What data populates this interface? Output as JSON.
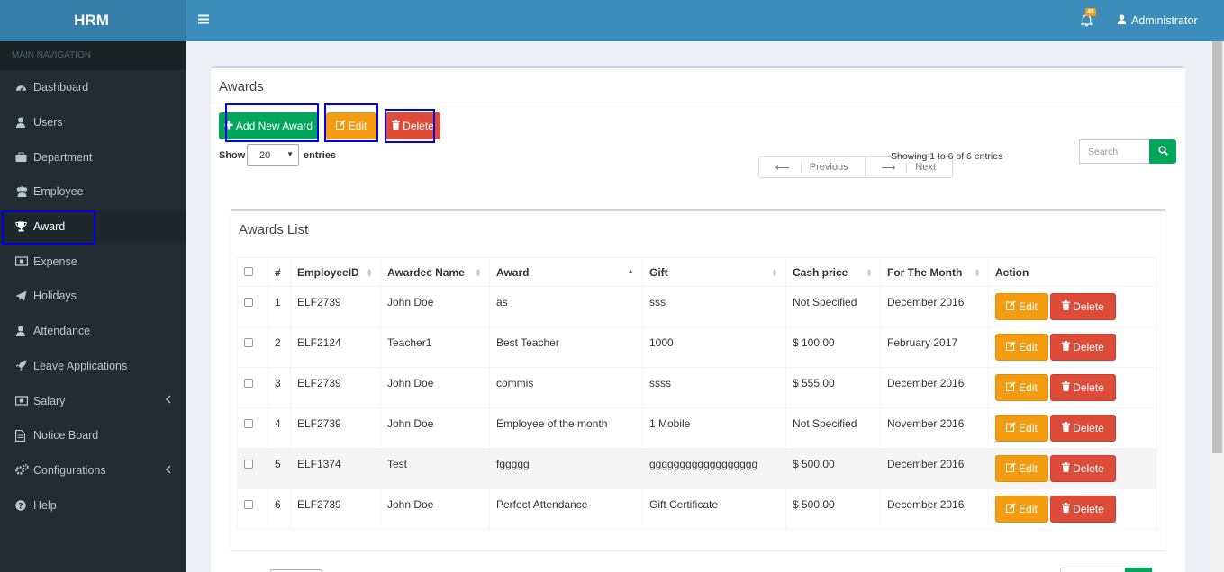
{
  "app": {
    "title": "HRM"
  },
  "sidebar": {
    "header": "MAIN NAVIGATION",
    "items": [
      {
        "label": "Dashboard",
        "icon": "dashboard-icon"
      },
      {
        "label": "Users",
        "icon": "user-icon"
      },
      {
        "label": "Department",
        "icon": "briefcase-icon"
      },
      {
        "label": "Employee",
        "icon": "users-icon"
      },
      {
        "label": "Award",
        "icon": "trophy-icon"
      },
      {
        "label": "Expense",
        "icon": "money-icon"
      },
      {
        "label": "Holidays",
        "icon": "paper-plane-icon"
      },
      {
        "label": "Attendance",
        "icon": "user-icon"
      },
      {
        "label": "Leave Applications",
        "icon": "rocket-icon"
      },
      {
        "label": "Salary",
        "icon": "money-icon"
      },
      {
        "label": "Notice Board",
        "icon": "file-icon"
      },
      {
        "label": "Configurations",
        "icon": "gears-icon"
      },
      {
        "label": "Help",
        "icon": "question-circle-icon"
      }
    ]
  },
  "header": {
    "notification_count": "45",
    "user_name": "Administrator"
  },
  "page": {
    "title": "Awards",
    "add_label": "Add New Award",
    "edit_label": "Edit",
    "delete_label": "Delete",
    "show_label": "Show",
    "page_size": "20",
    "entries_label": "entries",
    "previous_label": "Previous",
    "next_label": "Next",
    "showing_text": "Showing 1 to 6 of 6 entries",
    "search_placeholder": "Search"
  },
  "list": {
    "title": "Awards List",
    "columns": [
      "#",
      "EmployeeID",
      "Awardee Name",
      "Award",
      "Gift",
      "Cash price",
      "For The Month",
      "Action"
    ],
    "edit_label": "Edit",
    "delete_label": "Delete",
    "rows": [
      {
        "num": "1",
        "employee_id": "ELF2739",
        "name": "John Doe",
        "award": "as",
        "gift": "sss",
        "cash": "Not Specified",
        "month": "December 2016"
      },
      {
        "num": "2",
        "employee_id": "ELF2124",
        "name": "Teacher1",
        "award": "Best Teacher",
        "gift": "1000",
        "cash": "$ 100.00",
        "month": "February 2017"
      },
      {
        "num": "3",
        "employee_id": "ELF2739",
        "name": "John Doe",
        "award": "commis",
        "gift": "ssss",
        "cash": "$ 555.00",
        "month": "December 2016"
      },
      {
        "num": "4",
        "employee_id": "ELF2739",
        "name": "John Doe",
        "award": "Employee of the month",
        "gift": "1 Mobile",
        "cash": "Not Specified",
        "month": "November 2016"
      },
      {
        "num": "5",
        "employee_id": "ELF1374",
        "name": "Test",
        "award": "fggggg",
        "gift": "gggggggggggggggggg",
        "cash": "$ 500.00",
        "month": "December 2016"
      },
      {
        "num": "6",
        "employee_id": "ELF2739",
        "name": "John Doe",
        "award": "Perfect Attendance",
        "gift": "Gift Certificate",
        "cash": "$ 500.00",
        "month": "December 2016"
      }
    ]
  },
  "colors": {
    "sidebar": "#222d32",
    "header": "#3c8dbc",
    "logo": "#367fa9",
    "success": "#00a65a",
    "warning": "#f39c12",
    "danger": "#dd4b39",
    "highlight": "#0000ee"
  }
}
